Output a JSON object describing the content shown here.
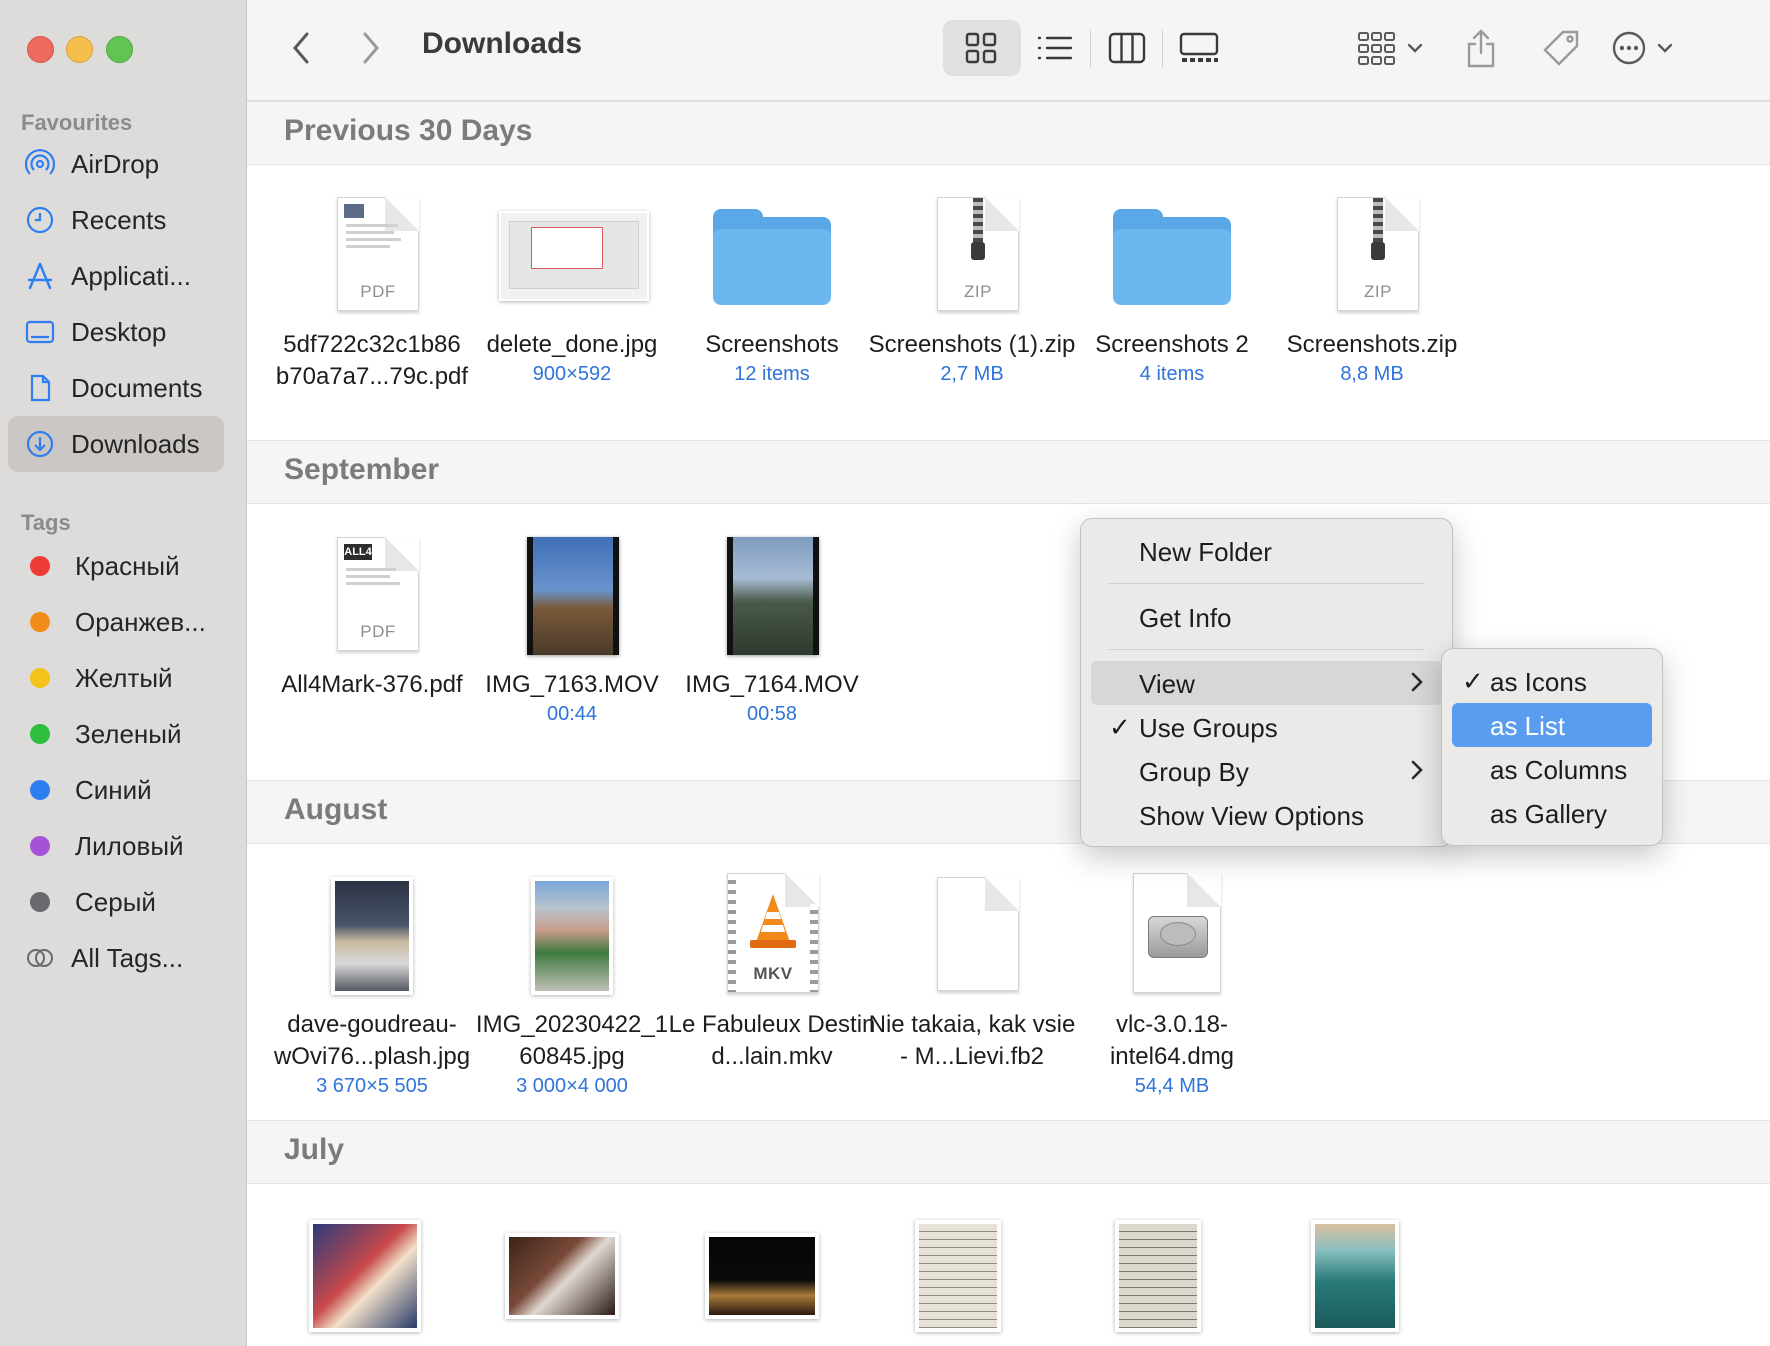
{
  "window": {
    "title": "Downloads"
  },
  "sidebar": {
    "favourites_heading": "Favourites",
    "favourites": [
      {
        "label": "AirDrop",
        "icon": "airdrop-icon"
      },
      {
        "label": "Recents",
        "icon": "clock-icon"
      },
      {
        "label": "Applicati...",
        "icon": "applications-icon"
      },
      {
        "label": "Desktop",
        "icon": "desktop-icon"
      },
      {
        "label": "Documents",
        "icon": "document-icon"
      },
      {
        "label": "Downloads",
        "icon": "download-icon",
        "selected": true
      }
    ],
    "tags_heading": "Tags",
    "tags": [
      {
        "label": "Красный",
        "color": "#ef3b37"
      },
      {
        "label": "Оранжев...",
        "color": "#f28c1b"
      },
      {
        "label": "Желтый",
        "color": "#f3c21b"
      },
      {
        "label": "Зеленый",
        "color": "#2dbe3e"
      },
      {
        "label": "Синий",
        "color": "#2f7ef0"
      },
      {
        "label": "Лиловый",
        "color": "#a452d6"
      },
      {
        "label": "Серый",
        "color": "#6a6a6e"
      },
      {
        "label": "All Tags...",
        "icon": "all-tags-icon"
      }
    ]
  },
  "groups": [
    {
      "title": "Previous 30 Days",
      "files": [
        {
          "name": "5df722c32c1b86 b70a7a7...79c.pdf",
          "meta": "",
          "kind": "PDF"
        },
        {
          "name": "delete_done.jpg",
          "meta": "900×592",
          "kind": "image"
        },
        {
          "name": "Screenshots",
          "meta": "12 items",
          "kind": "folder"
        },
        {
          "name": "Screenshots (1).zip",
          "meta": "2,7 MB",
          "kind": "ZIP"
        },
        {
          "name": "Screenshots 2",
          "meta": "4 items",
          "kind": "folder"
        },
        {
          "name": "Screenshots.zip",
          "meta": "8,8 MB",
          "kind": "ZIP"
        }
      ]
    },
    {
      "title": "September",
      "files": [
        {
          "name": "All4Mark-376.pdf",
          "meta": "",
          "kind": "PDF",
          "thumb_text": "ALL4"
        },
        {
          "name": "IMG_7163.MOV",
          "meta": "00:44",
          "kind": "video"
        },
        {
          "name": "IMG_7164.MOV",
          "meta": "00:58",
          "kind": "video"
        }
      ]
    },
    {
      "title": "August",
      "files": [
        {
          "name": "dave-goudreau-wOvi76...plash.jpg",
          "meta": "3 670×5 505",
          "kind": "photo"
        },
        {
          "name": "IMG_20230422_1 60845.jpg",
          "meta": "3 000×4 000",
          "kind": "photo"
        },
        {
          "name": "Le Fabuleux Destin d...lain.mkv",
          "meta": "",
          "kind": "MKV"
        },
        {
          "name": "Nie takaia, kak vsie - M...Lievi.fb2",
          "meta": "",
          "kind": "generic"
        },
        {
          "name": "vlc-3.0.18-intel64.dmg",
          "meta": "54,4 MB",
          "kind": "dmg"
        }
      ]
    },
    {
      "title": "July",
      "files": []
    }
  ],
  "context_menu": {
    "items": [
      "New Folder",
      "Get Info",
      "View",
      "Use Groups",
      "Group By",
      "Show View Options"
    ],
    "checkmark": "✓"
  },
  "view_submenu": {
    "items": [
      "as Icons",
      "as List",
      "as Columns",
      "as Gallery"
    ],
    "checked": "as Icons",
    "highlighted": "as List"
  }
}
